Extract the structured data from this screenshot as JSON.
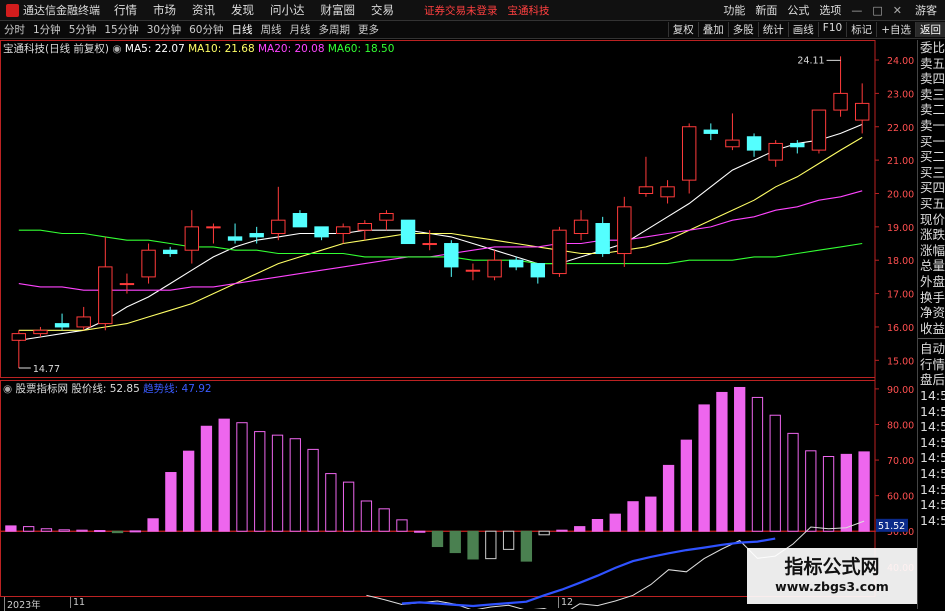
{
  "app": {
    "title": "通达信金融终端",
    "menu": [
      "行情",
      "市场",
      "资讯",
      "发现",
      "问小达",
      "财富圈",
      "交易"
    ],
    "notice1": "证券交易未登录",
    "notice2": "宝通科技",
    "right_menu": [
      "功能",
      "新面",
      "公式",
      "选项"
    ],
    "guest": "游客"
  },
  "toolbar": {
    "periods": [
      "分时",
      "1分钟",
      "5分钟",
      "15分钟",
      "30分钟",
      "60分钟",
      "日线",
      "周线",
      "月线",
      "多周期",
      "更多"
    ],
    "tools": [
      "复权",
      "叠加",
      "多股",
      "统计",
      "画线",
      "F10",
      "标记",
      "+自选",
      "返回"
    ]
  },
  "main_info": {
    "name": "宝通科技(日线 前复权)",
    "ma5": "MA5: 22.07",
    "ma10": "MA10: 21.68",
    "ma20": "MA20: 20.08",
    "ma60": "MA60: 18.50"
  },
  "ind_info": {
    "name": "股票指标网",
    "l1": "股价线: 52.85",
    "l2": "趋势线: 47.92"
  },
  "sidebar": {
    "top": [
      "委比",
      "卖五",
      "卖四",
      "卖三",
      "卖二",
      "卖一",
      "买一",
      "买二",
      "买三",
      "买四",
      "买五",
      "现价",
      "涨跌",
      "涨幅",
      "总量",
      "外盘",
      "换手",
      "净资",
      "收益"
    ],
    "bottom": [
      "自动",
      "行情",
      "盘后",
      "14:50",
      "14:50",
      "14:50",
      "14:50",
      "14:50",
      "14:50",
      "14:50",
      "14:50",
      "14:50"
    ]
  },
  "colors": {
    "up": "#ff3b3b",
    "down": "#54ffff",
    "ma5": "#ffffff",
    "ma10": "#ffff66",
    "ma20": "#ff44ff",
    "ma60": "#33ff33",
    "magenta_bar": "#ee66ee",
    "green_bar": "#4a8050",
    "axis_price": "#ff5050",
    "trend": "#2f52ff"
  },
  "chart_data": [
    {
      "type": "candlestick",
      "title": "宝通科技(日线 前复权)",
      "price_axis_ticks": [
        "24.00",
        "23.00",
        "22.00",
        "21.00",
        "20.00",
        "19.00",
        "18.00",
        "17.00",
        "16.00",
        "15.00"
      ],
      "ylim": [
        14.5,
        24.6
      ],
      "annotations": {
        "high_label": "24.11",
        "low_label": "14.77"
      },
      "candles": [
        {
          "o": 15.6,
          "c": 15.8,
          "h": 15.9,
          "l": 14.77
        },
        {
          "o": 15.8,
          "c": 15.9,
          "h": 16.0,
          "l": 15.7
        },
        {
          "o": 16.1,
          "c": 16.0,
          "h": 16.4,
          "l": 15.9
        },
        {
          "o": 16.0,
          "c": 16.3,
          "h": 16.6,
          "l": 15.9
        },
        {
          "o": 16.1,
          "c": 17.8,
          "h": 18.7,
          "l": 15.9
        },
        {
          "o": 17.3,
          "c": 17.3,
          "h": 17.6,
          "l": 17.0
        },
        {
          "o": 17.5,
          "c": 18.3,
          "h": 18.5,
          "l": 17.3
        },
        {
          "o": 18.3,
          "c": 18.2,
          "h": 18.4,
          "l": 18.1
        },
        {
          "o": 18.3,
          "c": 19.0,
          "h": 19.5,
          "l": 17.9
        },
        {
          "o": 19.0,
          "c": 19.0,
          "h": 19.1,
          "l": 18.5
        },
        {
          "o": 18.7,
          "c": 18.6,
          "h": 19.1,
          "l": 18.5
        },
        {
          "o": 18.8,
          "c": 18.7,
          "h": 19.0,
          "l": 18.5
        },
        {
          "o": 18.8,
          "c": 19.2,
          "h": 20.2,
          "l": 18.6
        },
        {
          "o": 19.4,
          "c": 19.0,
          "h": 19.5,
          "l": 19.0
        },
        {
          "o": 19.0,
          "c": 18.7,
          "h": 19.0,
          "l": 18.6
        },
        {
          "o": 18.8,
          "c": 19.0,
          "h": 19.1,
          "l": 18.5
        },
        {
          "o": 18.9,
          "c": 19.1,
          "h": 19.2,
          "l": 18.6
        },
        {
          "o": 19.2,
          "c": 19.4,
          "h": 19.5,
          "l": 18.9
        },
        {
          "o": 19.2,
          "c": 18.5,
          "h": 19.2,
          "l": 18.5
        },
        {
          "o": 18.5,
          "c": 18.5,
          "h": 18.9,
          "l": 18.3
        },
        {
          "o": 18.5,
          "c": 17.8,
          "h": 18.6,
          "l": 17.5
        },
        {
          "o": 17.7,
          "c": 17.7,
          "h": 17.9,
          "l": 17.4
        },
        {
          "o": 17.5,
          "c": 18.0,
          "h": 18.3,
          "l": 17.4
        },
        {
          "o": 18.0,
          "c": 17.8,
          "h": 18.1,
          "l": 17.7
        },
        {
          "o": 17.9,
          "c": 17.5,
          "h": 17.9,
          "l": 17.3
        },
        {
          "o": 17.6,
          "c": 18.9,
          "h": 19.0,
          "l": 17.5
        },
        {
          "o": 18.8,
          "c": 19.2,
          "h": 19.5,
          "l": 18.6
        },
        {
          "o": 19.1,
          "c": 18.2,
          "h": 19.3,
          "l": 18.1
        },
        {
          "o": 18.2,
          "c": 19.6,
          "h": 19.9,
          "l": 17.8
        },
        {
          "o": 20.0,
          "c": 20.2,
          "h": 21.1,
          "l": 19.9
        },
        {
          "o": 19.9,
          "c": 20.2,
          "h": 20.4,
          "l": 19.7
        },
        {
          "o": 20.4,
          "c": 22.0,
          "h": 22.1,
          "l": 20.0
        },
        {
          "o": 21.9,
          "c": 21.8,
          "h": 22.1,
          "l": 21.6
        },
        {
          "o": 21.4,
          "c": 21.6,
          "h": 22.4,
          "l": 21.3
        },
        {
          "o": 21.7,
          "c": 21.3,
          "h": 21.8,
          "l": 21.1
        },
        {
          "o": 21.0,
          "c": 21.5,
          "h": 21.6,
          "l": 20.8
        },
        {
          "o": 21.5,
          "c": 21.4,
          "h": 21.6,
          "l": 21.2
        },
        {
          "o": 21.3,
          "c": 22.5,
          "h": 22.5,
          "l": 21.2
        },
        {
          "o": 22.5,
          "c": 23.0,
          "h": 24.11,
          "l": 22.3
        },
        {
          "o": 22.2,
          "c": 22.7,
          "h": 23.3,
          "l": 21.8
        }
      ],
      "ma_series": [
        {
          "name": "MA5",
          "values": [
            15.6,
            15.7,
            15.8,
            15.9,
            16.2,
            16.6,
            16.9,
            17.3,
            17.7,
            18.1,
            18.4,
            18.6,
            18.7,
            18.8,
            18.8,
            18.8,
            18.9,
            18.9,
            18.9,
            18.8,
            18.7,
            18.5,
            18.3,
            18.1,
            17.9,
            17.9,
            18.1,
            18.3,
            18.5,
            18.9,
            19.3,
            19.7,
            20.2,
            20.7,
            21.0,
            21.3,
            21.5,
            21.6,
            21.8,
            22.07
          ]
        },
        {
          "name": "MA10",
          "values": [
            15.9,
            15.9,
            15.9,
            15.9,
            16.0,
            16.1,
            16.3,
            16.5,
            16.7,
            17.0,
            17.3,
            17.6,
            17.9,
            18.1,
            18.3,
            18.5,
            18.6,
            18.7,
            18.8,
            18.8,
            18.8,
            18.7,
            18.6,
            18.5,
            18.4,
            18.3,
            18.2,
            18.2,
            18.3,
            18.4,
            18.6,
            18.9,
            19.2,
            19.5,
            19.8,
            20.2,
            20.5,
            20.9,
            21.3,
            21.68
          ]
        },
        {
          "name": "MA20",
          "values": [
            17.3,
            17.2,
            17.2,
            17.1,
            17.1,
            17.1,
            17.1,
            17.1,
            17.2,
            17.2,
            17.3,
            17.4,
            17.5,
            17.6,
            17.7,
            17.8,
            17.9,
            18.0,
            18.1,
            18.1,
            18.2,
            18.3,
            18.4,
            18.4,
            18.4,
            18.5,
            18.5,
            18.6,
            18.6,
            18.7,
            18.8,
            18.9,
            19.0,
            19.2,
            19.3,
            19.5,
            19.6,
            19.8,
            19.9,
            20.08
          ]
        },
        {
          "name": "MA60",
          "values": [
            18.9,
            18.9,
            18.8,
            18.8,
            18.7,
            18.6,
            18.6,
            18.5,
            18.4,
            18.4,
            18.3,
            18.3,
            18.2,
            18.2,
            18.2,
            18.2,
            18.1,
            18.1,
            18.1,
            18.1,
            18.1,
            18.0,
            18.0,
            18.0,
            17.9,
            17.9,
            17.9,
            17.9,
            17.9,
            17.9,
            17.9,
            18.0,
            18.0,
            18.0,
            18.1,
            18.1,
            18.2,
            18.3,
            18.4,
            18.5
          ]
        }
      ]
    },
    {
      "type": "bar",
      "title": "股票指标网",
      "indicator_axis_ticks": [
        "90.00",
        "80.00",
        "70.00",
        "60.00",
        "50.00",
        "40.00"
      ],
      "ylim": [
        31.8,
        92.5
      ],
      "baseline": 50,
      "current_value_label": "51.52",
      "bars": [
        51.5,
        51.3,
        50.7,
        50.4,
        50.3,
        50.2,
        49.6,
        50.1,
        53.5,
        66.5,
        72.5,
        79.5,
        81.5,
        80.5,
        78.0,
        77.0,
        76.0,
        73.0,
        66.2,
        63.8,
        58.5,
        56.3,
        53.2,
        50.0,
        45.7,
        44.0,
        42.2,
        42.3,
        44.9,
        41.6,
        49.0,
        50.3,
        51.3,
        53.3,
        54.8,
        58.3,
        59.6,
        68.5,
        75.6,
        85.5,
        89.0,
        90.4,
        87.6,
        82.6,
        77.5,
        72.6,
        71.0,
        71.6,
        72.3
      ],
      "series": [
        {
          "name": "股价线",
          "values": [
            null,
            null,
            null,
            null,
            null,
            null,
            null,
            null,
            null,
            null,
            null,
            null,
            null,
            null,
            null,
            null,
            null,
            null,
            null,
            null,
            32.0,
            30.8,
            29.4,
            29.9,
            30.4,
            29.5,
            27.8,
            28.7,
            29.2,
            27.8,
            28.3,
            26.5,
            29.6,
            29.1,
            30.4,
            32.0,
            35.0,
            39.2,
            38.6,
            42.3,
            45.0,
            47.4,
            42.4,
            43.0,
            46.4,
            51.2,
            50.7,
            51.0,
            52.85
          ]
        },
        {
          "name": "趋势线",
          "values": [
            null,
            null,
            null,
            null,
            null,
            null,
            null,
            null,
            null,
            null,
            null,
            null,
            null,
            null,
            null,
            null,
            null,
            null,
            null,
            null,
            null,
            null,
            29.7,
            30.0,
            29.7,
            29.3,
            29.0,
            29.4,
            29.8,
            30.2,
            32.0,
            33.6,
            35.5,
            37.5,
            39.7,
            41.6,
            42.8,
            43.8,
            44.7,
            45.4,
            46.2,
            46.8,
            47.1,
            47.92
          ]
        }
      ]
    }
  ],
  "date_axis": [
    {
      "label": "2023年",
      "major": true
    },
    {
      "label": "11",
      "major": false
    },
    {
      "label": "12",
      "major": false
    }
  ],
  "watermark": {
    "line1": "指标公式网",
    "line2": "www.zbgs3.com"
  }
}
